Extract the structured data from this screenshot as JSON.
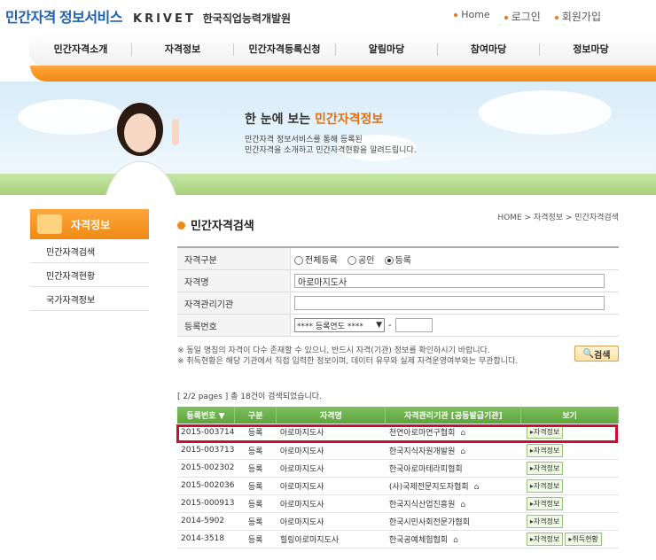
{
  "header": {
    "logo_part1": "민간자격",
    "logo_part2": "정보서비스",
    "logo_krivet": "KRIVET",
    "logo_org": "한국직업능력개발원",
    "util": [
      "Home",
      "로그인",
      "회원가입"
    ]
  },
  "gnb": [
    "민간자격소개",
    "자격정보",
    "민간자격등록신청",
    "알림마당",
    "참여마당",
    "정보마당"
  ],
  "visual": {
    "tagline_pre": "한 눈에 보는",
    "tagline_hl": "민간자격정보",
    "desc_line1": "민간자격 정보서비스를 통해 등록된",
    "desc_line2": "민간자격을 소개하고 민간자격현황을 알려드립니다."
  },
  "side": {
    "title": "자격정보",
    "items": [
      "민간자격검색",
      "민간자격현황",
      "국가자격정보"
    ]
  },
  "page": {
    "title": "민간자격검색",
    "breadcrumb": "HOME > 자격정보 > 민간자격검색"
  },
  "form": {
    "type_label": "자격구분",
    "type_options": [
      "전체등록",
      "공인",
      "등록"
    ],
    "name_label": "자격명",
    "name_value": "아로마지도사",
    "agency_label": "자격관리기관",
    "agency_value": "",
    "regno_label": "등록번호",
    "regno_select": "**** 등록연도 ****",
    "regno_dash": "-",
    "note1": "※ 동일 명칭의 자격이 다수 존재할 수 있으니, 반드시 자격(기관) 정보를 확인하시기 바랍니다.",
    "note2": "※ 취득현황은 해당 기관에서 직접 입력한 정보이며, 데이터 유무와 실제 자격운영여부와는 무관합니다.",
    "search_button": "검색"
  },
  "results": {
    "count_text": "[ 2/2 pages ] 총 18건이 검색되었습니다.",
    "headers": [
      "등록번호 ▼",
      "구분",
      "자격명",
      "자격관리기관 [공동발급기관]",
      "보기"
    ],
    "rows": [
      {
        "no": "2015-003714",
        "type": "등록",
        "name": "아로마지도사",
        "agency": "천연아로마연구협회",
        "home": true,
        "buttons": [
          "자격정보"
        ]
      },
      {
        "no": "2015-003713",
        "type": "등록",
        "name": "아로마지도사",
        "agency": "한국지식자원개발원",
        "home": true,
        "buttons": [
          "자격정보"
        ]
      },
      {
        "no": "2015-002302",
        "type": "등록",
        "name": "아로마지도사",
        "agency": "한국아로마테라피협회",
        "home": false,
        "buttons": [
          "자격정보"
        ]
      },
      {
        "no": "2015-002036",
        "type": "등록",
        "name": "아로마지도사",
        "agency": "(사)국제전문지도자협회",
        "home": true,
        "buttons": [
          "자격정보"
        ]
      },
      {
        "no": "2015-000913",
        "type": "등록",
        "name": "아로마지도사",
        "agency": "한국지식산업진흥원",
        "home": true,
        "buttons": [
          "자격정보"
        ]
      },
      {
        "no": "2014-5902",
        "type": "등록",
        "name": "아로마지도사",
        "agency": "한국시민사회전문가협회",
        "home": false,
        "buttons": [
          "자격정보"
        ]
      },
      {
        "no": "2014-3518",
        "type": "등록",
        "name": "힐링아로마지도사",
        "agency": "한국공예체험협회",
        "home": true,
        "buttons": [
          "자격정보",
          "취득현황"
        ]
      }
    ]
  }
}
